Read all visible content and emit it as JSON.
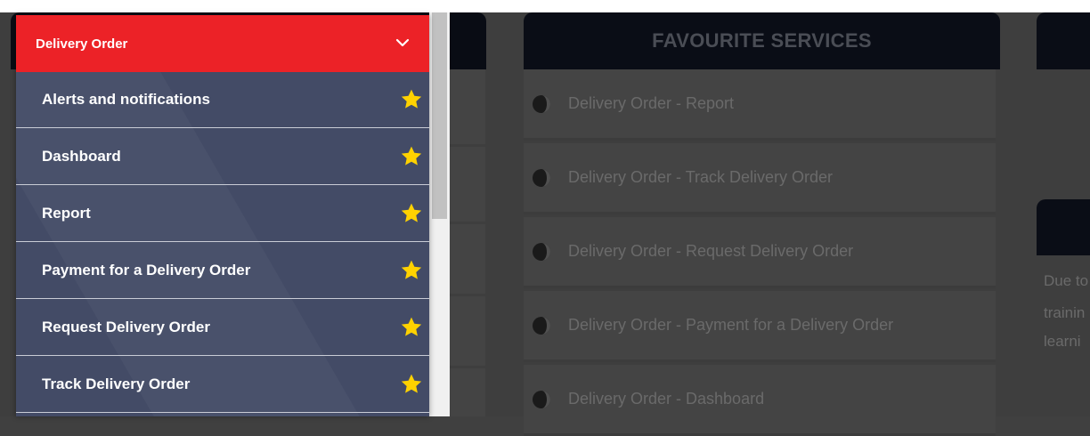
{
  "colors": {
    "dropdown_header_bg": "#ec2227",
    "dropdown_bg": "#434b66",
    "star_color": "#ffd200",
    "overlay_bg": "#3e3e3e"
  },
  "menu": {
    "title": "Delivery Order",
    "toggle_icon": "chevron-down-icon",
    "items": [
      {
        "label": "Alerts and notifications",
        "icon": "star-icon"
      },
      {
        "label": "Dashboard",
        "icon": "star-icon"
      },
      {
        "label": "Report",
        "icon": "star-icon"
      },
      {
        "label": "Payment for a Delivery Order",
        "icon": "star-icon"
      },
      {
        "label": "Request Delivery Order",
        "icon": "star-icon"
      },
      {
        "label": "Track Delivery Order",
        "icon": "star-icon"
      }
    ]
  },
  "favourites": {
    "title": "FAVOURITE SERVICES",
    "items": [
      {
        "label": "Delivery Order - Report"
      },
      {
        "label": "Delivery Order - Track Delivery Order"
      },
      {
        "label": "Delivery Order - Request Delivery Order"
      },
      {
        "label": "Delivery Order - Payment for a Delivery Order"
      },
      {
        "label": "Delivery Order - Dashboard"
      }
    ]
  },
  "side_panel": {
    "lines": [
      "Due to",
      "trainin",
      "learni"
    ]
  }
}
